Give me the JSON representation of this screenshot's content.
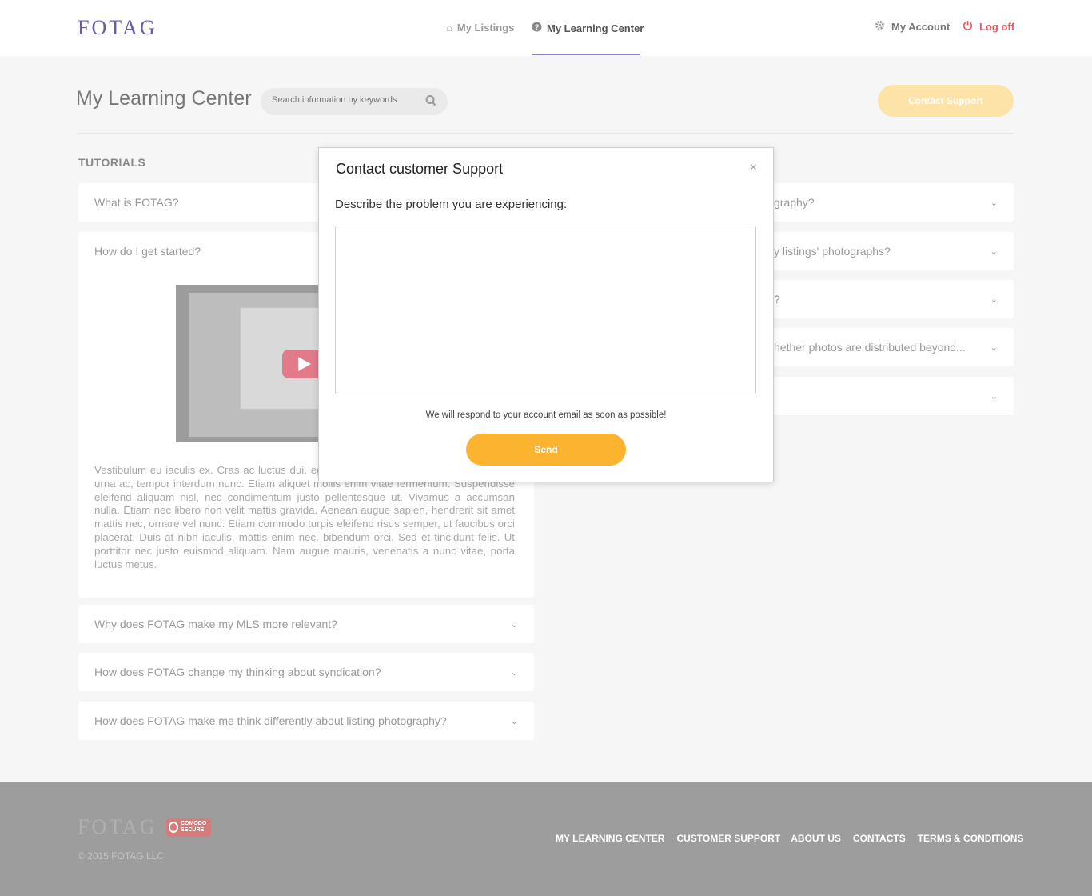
{
  "header": {
    "logo": "FOTAG",
    "nav": [
      {
        "label": "My Listings",
        "icon": "home-icon"
      },
      {
        "label": "My Learning Center",
        "icon": "question-circle-icon"
      }
    ],
    "account_label": "My Account",
    "logoff_label": "Log off"
  },
  "page": {
    "title": "My Learning Center",
    "search_placeholder": "Search information by keywords",
    "contact_button": "Contact Support",
    "section_title": "TUTORIALS"
  },
  "left_accordions": [
    {
      "question": "What is FOTAG?"
    },
    {
      "question": "How do I get started?"
    },
    {
      "question": "Why does FOTAG make my MLS more relevant?"
    },
    {
      "question": "How does FOTAG change my thinking about syndication?"
    },
    {
      "question": "How does FOTAG make me think differently about listing photography?"
    }
  ],
  "right_accordions": [
    {
      "question_visible": "graphy?"
    },
    {
      "question_visible": "y listings' photographs?"
    },
    {
      "question_visible": "?"
    },
    {
      "question_visible": "hether photos are distributed beyond..."
    },
    {
      "question_visible": ""
    }
  ],
  "expanded_text": "Vestibulum eu iaculis ex. Cras ac luctus dui. egestas nibh. Duis velit massa, pretium ac urna ac, tempor interdum nunc. Etiam aliquet mollis enim vitae fermentum. Suspendisse eleifend aliquam nisl, nec condimentum justo pellentesque ut. Vivamus a accumsan nulla. Etiam nec libero non velit mattis gravida. Aenean augue sapien, hendrerit sit amet mattis nec, ornare vel nunc. Etiam commodo turpis eleifend risus semper, ut faucibus orci placerat. Duis at nibh iaculis, mattis enim nec, bibendum orci. Sed et tincidunt felis. Ut porttitor nec justo euismod aliquam. Nam augue mauris, venenatis a nunc vitae, porta luctus metus.",
  "modal": {
    "title": "Contact customer Support",
    "close": "×",
    "label": "Describe the problem you are experiencing:",
    "note": "We will respond to your account email as soon as possible!",
    "send": "Send"
  },
  "footer": {
    "logo": "FOTAG",
    "badge": "COMODO SECURE",
    "copyright": "© 2015 FOTAG LLC",
    "links": [
      "MY LEARNING CENTER",
      "CUSTOMER SUPPORT",
      "ABOUT US",
      "CONTACTS",
      "TERMS & CONDITIONS"
    ]
  },
  "colors": {
    "brand": "#6b5aa6",
    "accent": "#fcb430",
    "logoff": "#e8585b",
    "footer_bg": "#9d9d9d"
  }
}
